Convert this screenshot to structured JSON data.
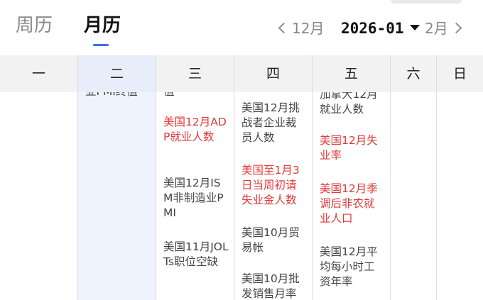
{
  "header": {
    "tabs": [
      {
        "label": "周历",
        "active": false
      },
      {
        "label": "月历",
        "active": true
      }
    ],
    "prev_month": "12月",
    "current_month": "2026-01",
    "next_month": "2月",
    "colors": {
      "accent": "#3d6fe0",
      "important": "#e03a3a"
    }
  },
  "weekdays": [
    "一",
    "二",
    "三",
    "四",
    "五",
    "六",
    "日"
  ],
  "columns": {
    "tue": {
      "events": [
        {
          "text": "业PMI终值",
          "important": false
        }
      ]
    },
    "wed": {
      "events": [
        {
          "text": "值",
          "important": false
        },
        {
          "text": "美国12月ADP就业人数",
          "important": true
        },
        {
          "text": "美国12月ISM非制造业PMI",
          "important": false
        },
        {
          "text": "美国11月JOLTs职位空缺",
          "important": false
        }
      ]
    },
    "thu": {
      "events": [
        {
          "text": "美国12月挑战者企业裁员人数",
          "important": false
        },
        {
          "text": "美国至1月3日当周初请失业金人数",
          "important": true
        },
        {
          "text": "美国10月贸易帐",
          "important": false
        },
        {
          "text": "美国10月批发销售月率",
          "important": false
        }
      ]
    },
    "fri": {
      "events": [
        {
          "text": "加拿大12月就业人数",
          "important": false
        },
        {
          "text": "美国12月失业率",
          "important": true
        },
        {
          "text": "美国12月季调后非农就业人口",
          "important": true
        },
        {
          "text": "美国12月平均每小时工资年率",
          "important": false
        }
      ]
    }
  }
}
